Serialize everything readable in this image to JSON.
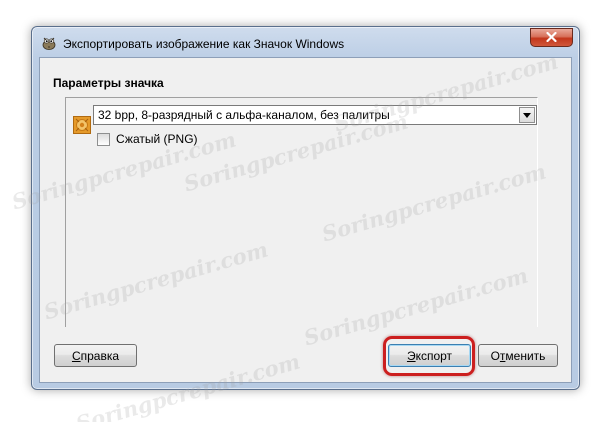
{
  "window": {
    "title": "Экспортировать изображение как Значок Windows"
  },
  "section": {
    "label": "Параметры значка"
  },
  "format_select": {
    "value": "32 bpp, 8-разрядный с альфа-каналом, без палитры"
  },
  "compressed_checkbox": {
    "label": "Сжатый (PNG)",
    "checked": false
  },
  "buttons": {
    "help": {
      "label": "Справка",
      "mnemonic_index": 0
    },
    "export": {
      "label": "Экспорт",
      "mnemonic_index": 0
    },
    "cancel": {
      "label": "Отменить",
      "mnemonic_index": 1
    }
  },
  "watermark": {
    "text": "Soringpcrepair.com"
  },
  "colors": {
    "highlight": "#cc1f1f",
    "close_button": "#c3361b",
    "dialog_background": "#f0f0f0"
  },
  "icons": [
    "gimp-app-icon",
    "close-icon",
    "image-preview-icon",
    "dropdown-arrow-icon"
  ]
}
